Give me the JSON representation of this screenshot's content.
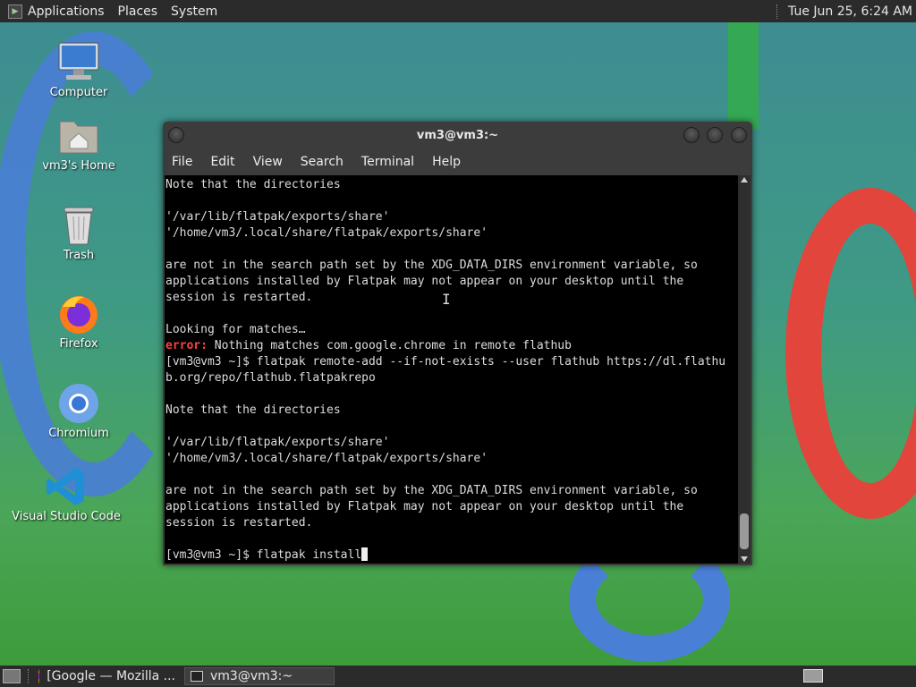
{
  "top_panel": {
    "menus": [
      "Applications",
      "Places",
      "System"
    ],
    "clock": "Tue Jun 25,  6:24 AM"
  },
  "desktop_icons": [
    {
      "label": "Computer",
      "icon": "computer-icon"
    },
    {
      "label": "vm3's Home",
      "icon": "home-folder-icon"
    },
    {
      "label": "Trash",
      "icon": "trash-icon"
    },
    {
      "label": "Firefox",
      "icon": "firefox-icon"
    },
    {
      "label": "Chromium",
      "icon": "chromium-icon"
    },
    {
      "label": "Visual Studio Code",
      "icon": "vscode-icon"
    }
  ],
  "terminal": {
    "title": "vm3@vm3:~",
    "menu": [
      "File",
      "Edit",
      "View",
      "Search",
      "Terminal",
      "Help"
    ],
    "lines": [
      "Note that the directories",
      "",
      "'/var/lib/flatpak/exports/share'",
      "'/home/vm3/.local/share/flatpak/exports/share'",
      "",
      "are not in the search path set by the XDG_DATA_DIRS environment variable, so",
      "applications installed by Flatpak may not appear on your desktop until the",
      "session is restarted.",
      "",
      "Looking for matches…",
      "error:| Nothing matches com.google.chrome in remote flathub",
      "[vm3@vm3 ~]$ flatpak remote-add --if-not-exists --user flathub https://dl.flathu",
      "b.org/repo/flathub.flatpakrepo",
      "",
      "Note that the directories",
      "",
      "'/var/lib/flatpak/exports/share'",
      "'/home/vm3/.local/share/flatpak/exports/share'",
      "",
      "are not in the search path set by the XDG_DATA_DIRS environment variable, so",
      "applications installed by Flatpak may not appear on your desktop until the",
      "session is restarted.",
      "",
      "[vm3@vm3 ~]$ flatpak install"
    ],
    "error_color": "#ff4040"
  },
  "taskbar": {
    "tasks": [
      {
        "label": "[Google — Mozilla ...",
        "icon": "firefox-icon",
        "active": false
      },
      {
        "label": "vm3@vm3:~",
        "icon": "terminal-icon",
        "active": true
      }
    ]
  }
}
